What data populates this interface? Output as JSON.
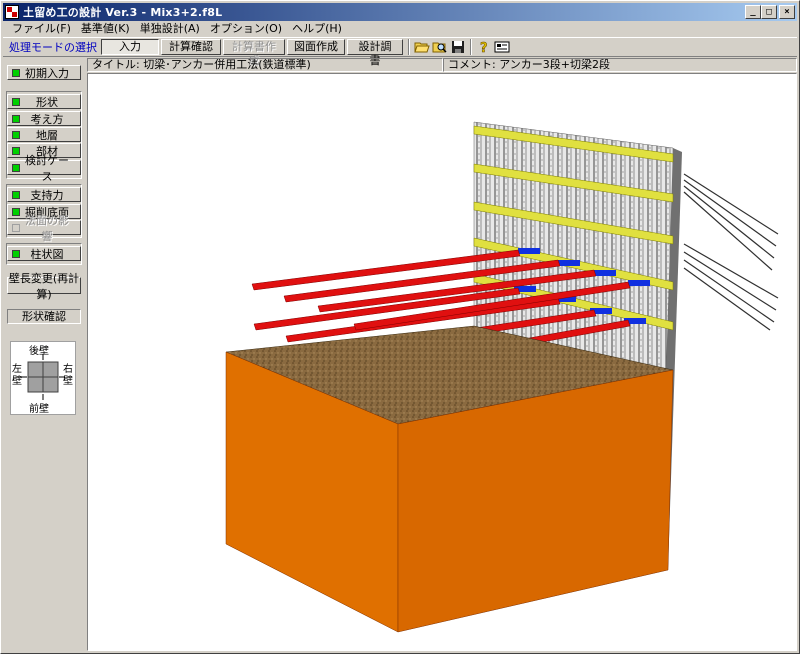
{
  "window": {
    "title": "土留め工の設計 Ver.3 - Mix3+2.f8L",
    "minimize": "_",
    "maximize": "□",
    "close": "×"
  },
  "menu": [
    {
      "label": "ファイル(F)"
    },
    {
      "label": "基準値(K)"
    },
    {
      "label": "単独設計(A)"
    },
    {
      "label": "オプション(O)"
    },
    {
      "label": "ヘルプ(H)"
    }
  ],
  "toolbar": {
    "mode_label": "処理モードの選択",
    "buttons": [
      {
        "label": "入力"
      },
      {
        "label": "計算確認"
      },
      {
        "label": "計算書作成"
      },
      {
        "label": "図面作成"
      },
      {
        "label": "設計調書"
      }
    ],
    "icons": [
      "open-folder-icon",
      "search-folder-icon",
      "save-icon",
      "help-icon",
      "info-icon"
    ]
  },
  "infobar": {
    "title": "タイトル: 切梁･アンカー併用工法(鉄道標準)",
    "comment": "コメント: アンカー3段+切梁2段"
  },
  "leftpanel": {
    "initial_input": "初期入力",
    "shape": "形状",
    "concept": "考え方",
    "ground": "地層",
    "members": "部材",
    "check_case": "検討ケース",
    "bearing": "支持力",
    "excavation_bottom": "掘削底面",
    "slope_influence": "法面の影響",
    "column_chart": "柱状図",
    "wall_length_change": "壁長変更(再計算)",
    "shape_check": "形状確認",
    "orientation": {
      "back": "後壁",
      "front": "前壁",
      "left": "左壁",
      "right": "右壁"
    }
  },
  "colors": {
    "title_start": "#0a246a",
    "title_end": "#a6caf0",
    "lamp_on": "#00d000",
    "soil_block": "#e07000",
    "strut_red": "#e01010",
    "wale_yellow": "#e0e040",
    "anchor_blue": "#1030e0"
  }
}
